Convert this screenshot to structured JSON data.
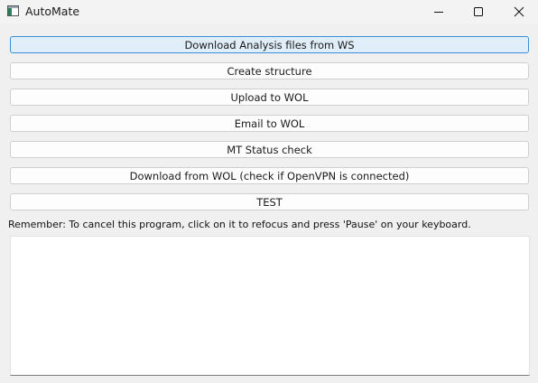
{
  "window": {
    "title": "AutoMate"
  },
  "buttons": [
    {
      "label": "Download Analysis files from WS"
    },
    {
      "label": "Create structure"
    },
    {
      "label": "Upload to WOL"
    },
    {
      "label": "Email to WOL"
    },
    {
      "label": "MT Status check"
    },
    {
      "label": "Download from WOL (check if OpenVPN is connected)"
    },
    {
      "label": "TEST"
    }
  ],
  "notice": "Remember: To cancel this program, click on it to refocus and press 'Pause' on your keyboard.",
  "log": {
    "content": ""
  },
  "colors": {
    "accent": "#3a8fd9",
    "focused_button_bg": "#e0eef9",
    "window_bg": "#f0f0f0"
  }
}
